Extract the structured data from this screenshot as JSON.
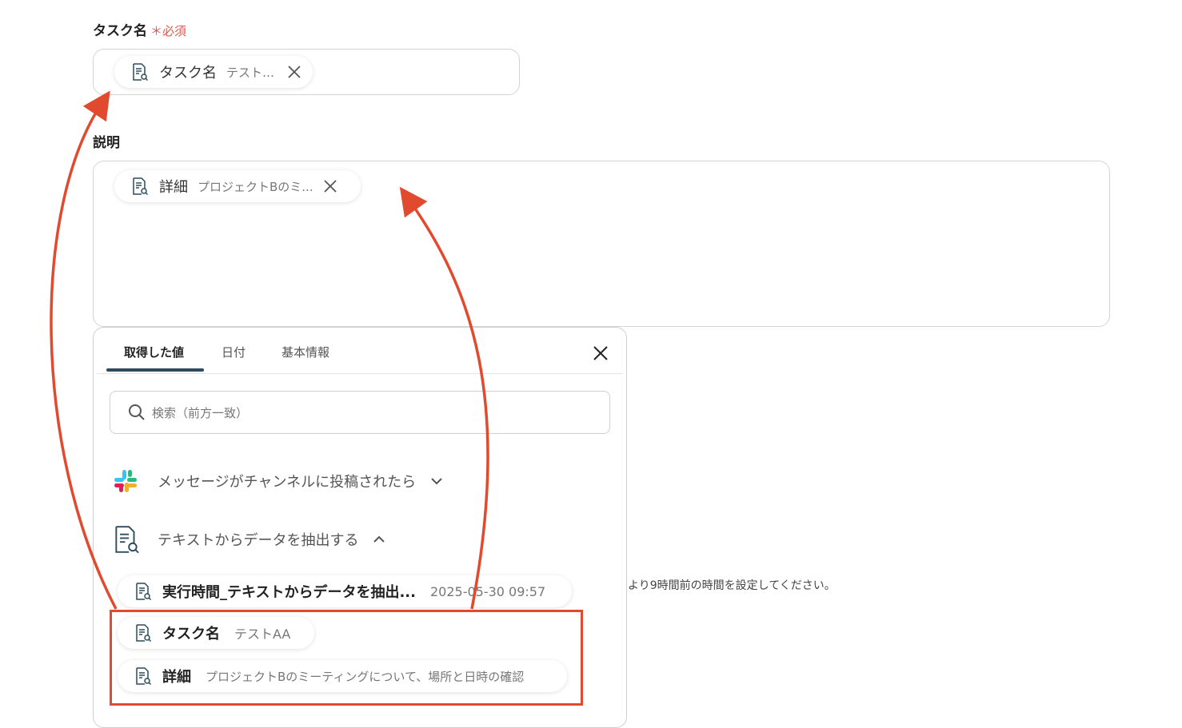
{
  "task_field": {
    "label": "タスク名",
    "required_mark": "＊必須",
    "chip": {
      "title": "タスク名",
      "value": "テストAA"
    }
  },
  "description_field": {
    "label": "説明",
    "chip": {
      "title": "詳細",
      "value": "プロジェクトBのミ..."
    }
  },
  "panel": {
    "tabs": [
      {
        "label": "取得した値",
        "active": true
      },
      {
        "label": "日付",
        "active": false
      },
      {
        "label": "基本情報",
        "active": false
      }
    ],
    "search_placeholder": "検索（前方一致）",
    "groups": [
      {
        "label": "メッセージがチャンネルに投稿されたら",
        "expanded": false,
        "icon": "slack-icon"
      },
      {
        "label": "テキストからデータを抽出する",
        "expanded": true,
        "icon": "document-search-icon"
      }
    ],
    "items": [
      {
        "title": "実行時間_テキストからデータを抽出...",
        "value": "2025-05-30 09:57"
      },
      {
        "title": "タスク名",
        "value": "テストAA"
      },
      {
        "title": "詳細",
        "value": "プロジェクトBのミーティングについて、場所と日時の確認"
      }
    ]
  },
  "hint_text": "より9時間前の時間を設定してください。",
  "colors": {
    "accent": "#2c4b5e",
    "required": "#e2574c",
    "highlight": "#e24a30"
  }
}
